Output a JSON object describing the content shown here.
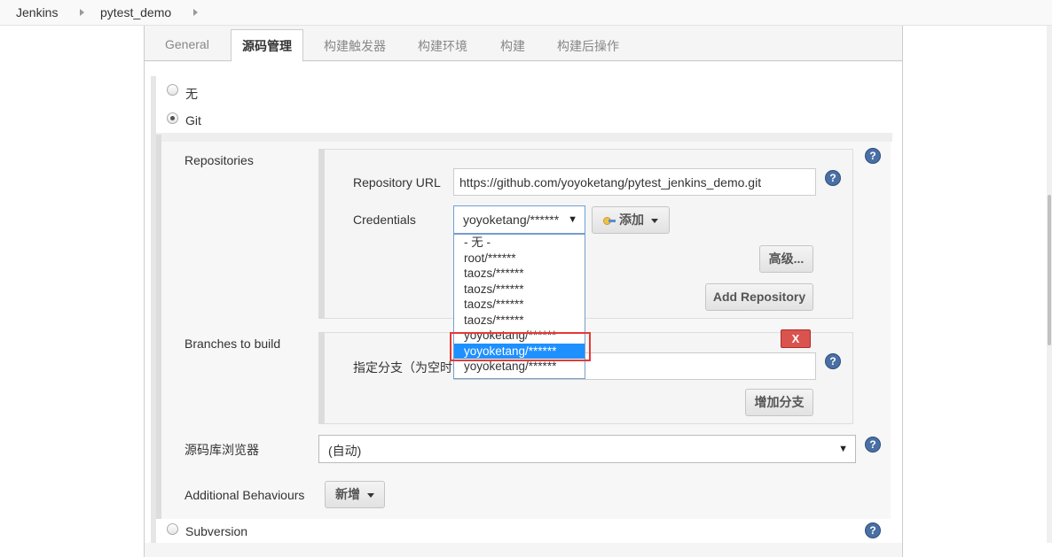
{
  "breadcrumb": {
    "root": "Jenkins",
    "job": "pytest_demo"
  },
  "tabs": [
    "General",
    "源码管理",
    "构建触发器",
    "构建环境",
    "构建",
    "构建后操作"
  ],
  "scm": {
    "none_label": "无",
    "git_label": "Git",
    "subversion_label": "Subversion",
    "selected": "Git"
  },
  "repositories": {
    "label": "Repositories",
    "url_label": "Repository URL",
    "url_value": "https://github.com/yoyoketang/pytest_jenkins_demo.git",
    "credentials_label": "Credentials",
    "credentials_value": "yoyoketang/******",
    "add_label": "添加",
    "advanced_label": "高级...",
    "add_repository_label": "Add Repository"
  },
  "credentials_options": [
    "- 无 -",
    "root/******",
    "taozs/******",
    "taozs/******",
    "taozs/******",
    "taozs/******",
    "yoyoketang/******",
    "yoyoketang/******",
    "yoyoketang/******"
  ],
  "credentials_highlighted_index": 7,
  "branches": {
    "label": "Branches to build",
    "specifier_label": "指定分支（为空时",
    "delete_label": "X",
    "add_branch_label": "增加分支"
  },
  "browser": {
    "label": "源码库浏览器",
    "value": "(自动)"
  },
  "behaviours": {
    "label": "Additional Behaviours",
    "add_label": "新增"
  },
  "help_icon_glyph": "?",
  "colors": {
    "highlight": "#1e90ff",
    "annotation_box": "#e53935",
    "delete_button": "#d9534f"
  }
}
